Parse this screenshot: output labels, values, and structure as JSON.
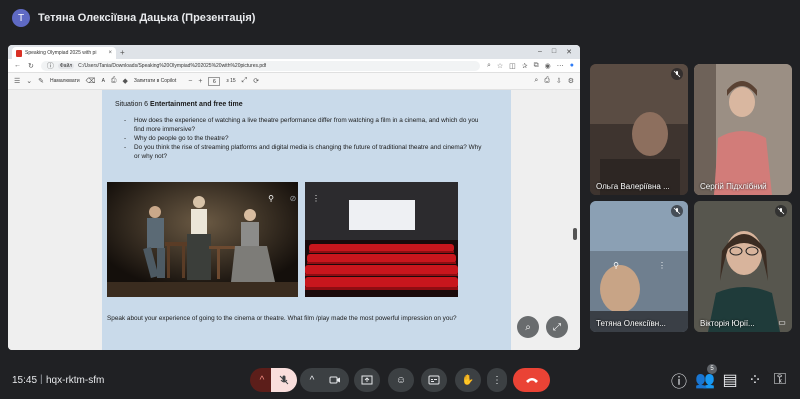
{
  "presenter": {
    "avatar_letter": "T",
    "title": "Тетяна Олексіївна Дацька (Презентація)"
  },
  "browser": {
    "tab_title": "Speaking Olympiad 2025 with pi",
    "tab_close": "×",
    "new_tab": "+",
    "url_chip": "Файл",
    "url": "C:/Users/Tania/Downloads/Speaking%20Olympiad%202025%20with%20pictures.pdf",
    "toolbar": {
      "draw_label": "Намалювати",
      "text_label": "A",
      "copilot_label": "Запитати в Copilot",
      "page_current": "6",
      "page_total": "з 15"
    }
  },
  "document": {
    "situation_prefix": "Situation 6",
    "situation_title": "Entertainment and free time",
    "questions": [
      "How does the experience of watching a live theatre performance differ from watching a film in a cinema, and which do you find more immersive?",
      "Why do people go to the theatre?",
      "Do you think the rise of streaming platforms and digital media is changing the future of traditional theatre and cinema? Why or why not?"
    ],
    "speak_text": "Speak about your experience of going to the cinema or theatre. What film /play made the most powerful impression on you?"
  },
  "participants": [
    {
      "name": "Ольга Валеріївна ...",
      "muted": true
    },
    {
      "name": "Сергій Підхлібний",
      "muted": false
    },
    {
      "name": "Тетяна Олексіївн...",
      "muted": true
    },
    {
      "name": "Вікторія Юрії...",
      "muted": true
    }
  ],
  "bottom": {
    "time": "15:45",
    "separator": "|",
    "meeting_code": "hqx-rktm-sfm",
    "people_count": "5"
  },
  "colors": {
    "call_background": "#202124",
    "end_call": "#ea4335",
    "pdf_page": "#c9daea"
  }
}
